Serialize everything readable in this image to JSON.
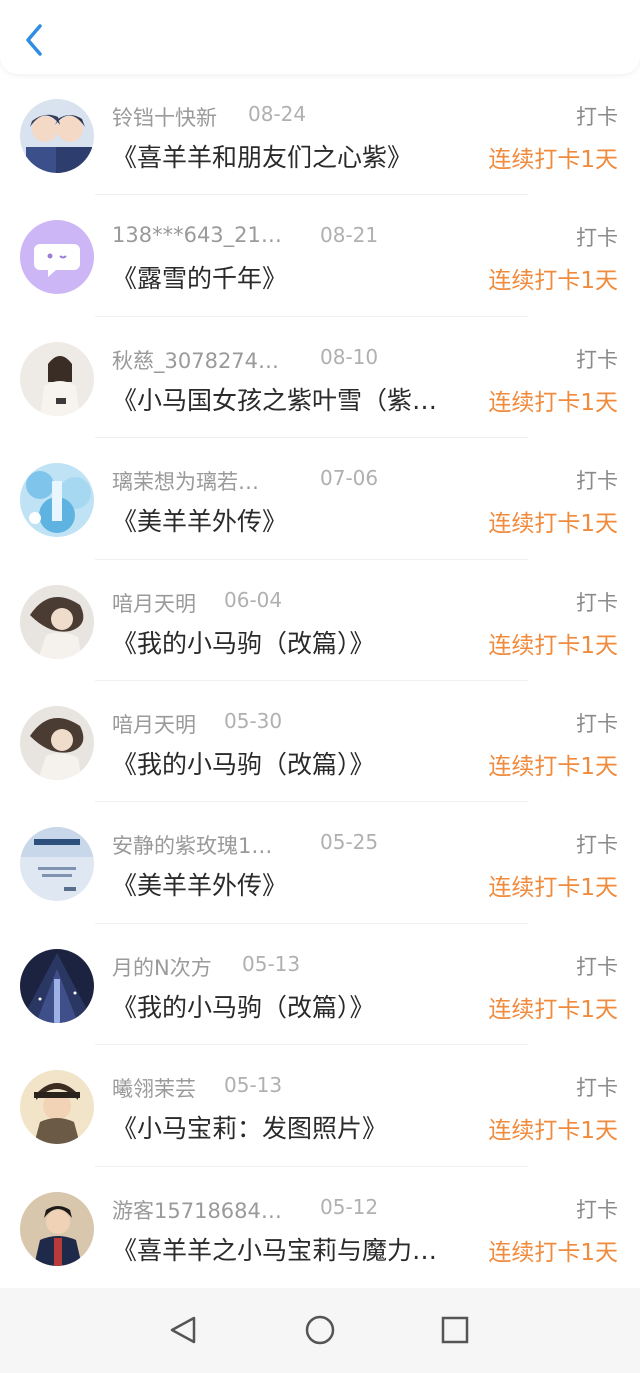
{
  "header": {
    "back_icon": "chevron-left-icon"
  },
  "colors": {
    "accent_orange": "#f08a3c",
    "back_blue": "#2f8de4"
  },
  "items": [
    {
      "user": "铃铛十快新",
      "date": "08-24",
      "checkin": "打卡",
      "title": "《喜羊羊和朋友们之心紫》",
      "streak": "连续打卡1天"
    },
    {
      "user": "138***643_215…",
      "date": "08-21",
      "checkin": "打卡",
      "title": "《露雪的千年》",
      "streak": "连续打卡1天"
    },
    {
      "user": "秋慈_3078274…",
      "date": "08-10",
      "checkin": "打卡",
      "title": "《小马国女孩之紫叶雪（紫…",
      "streak": "连续打卡1天"
    },
    {
      "user": "璃茉想为璃若…",
      "date": "07-06",
      "checkin": "打卡",
      "title": "《美羊羊外传》",
      "streak": "连续打卡1天"
    },
    {
      "user": "喑月天明",
      "date": "06-04",
      "checkin": "打卡",
      "title": "《我的小马驹（改篇）》",
      "streak": "连续打卡1天"
    },
    {
      "user": "喑月天明",
      "date": "05-30",
      "checkin": "打卡",
      "title": "《我的小马驹（改篇）》",
      "streak": "连续打卡1天"
    },
    {
      "user": "安静的紫玫瑰1…",
      "date": "05-25",
      "checkin": "打卡",
      "title": "《美羊羊外传》",
      "streak": "连续打卡1天"
    },
    {
      "user": "月的N次方",
      "date": "05-13",
      "checkin": "打卡",
      "title": "《我的小马驹（改篇）》",
      "streak": "连续打卡1天"
    },
    {
      "user": "曦翎茉芸",
      "date": "05-13",
      "checkin": "打卡",
      "title": "《小马宝莉：发图照片》",
      "streak": "连续打卡1天"
    },
    {
      "user": "游客15718684…",
      "date": "05-12",
      "checkin": "打卡",
      "title": "《喜羊羊之小马宝莉与魔力…",
      "streak": "连续打卡1天"
    }
  ],
  "navbar": {
    "back": "triangle-back-icon",
    "home": "circle-home-icon",
    "recents": "square-recents-icon"
  }
}
